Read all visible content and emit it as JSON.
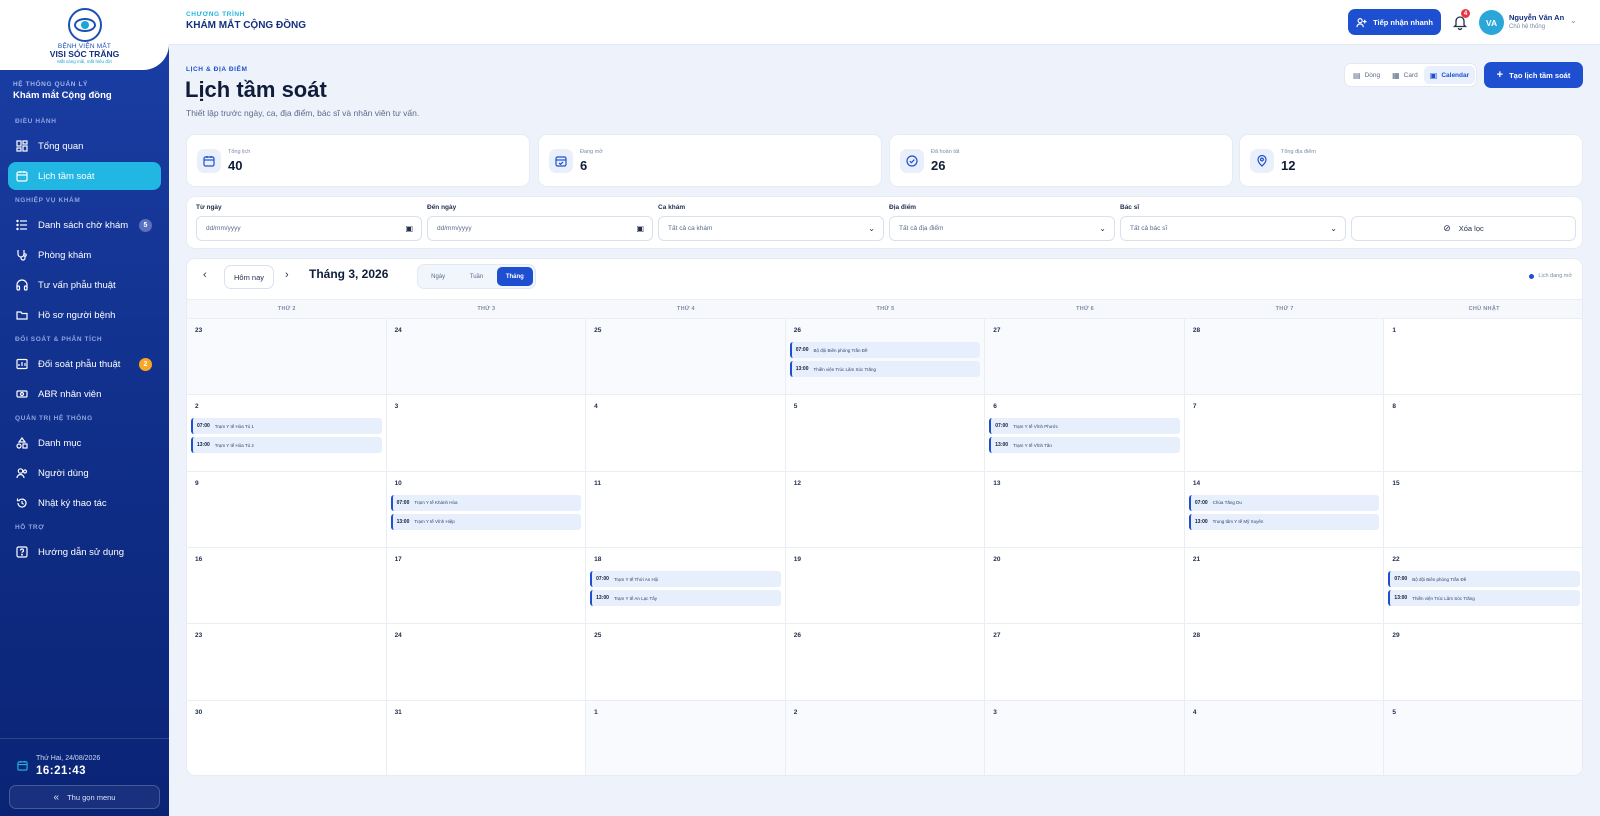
{
  "logo": {
    "line1": "BỆNH VIỆN MẮT",
    "line2": "VISI SÓC TRĂNG",
    "tagline": "Mắt sáng mãi, mắt hiểu đời"
  },
  "sidebar": {
    "system_label": "HỆ THỐNG QUẢN LÝ",
    "system_name": "Khám mắt Cộng đồng",
    "sections": [
      "ĐIỀU HÀNH",
      "NGHIỆP VỤ KHÁM",
      "ĐỐI SOÁT & PHÂN TÍCH",
      "QUẢN TRỊ HỆ THỐNG",
      "HỖ TRỢ"
    ],
    "items": [
      {
        "label": "Tổng quan",
        "icon": "dashboard-icon"
      },
      {
        "label": "Lịch tầm soát",
        "icon": "calendar-icon",
        "active": true
      },
      {
        "label": "Danh sách chờ khám",
        "icon": "list-icon",
        "badge": "5"
      },
      {
        "label": "Phòng khám",
        "icon": "stethoscope-icon"
      },
      {
        "label": "Tư vấn phẫu thuật",
        "icon": "consult-icon"
      },
      {
        "label": "Hồ sơ người bệnh",
        "icon": "folder-icon"
      },
      {
        "label": "Đối soát phẫu thuật",
        "icon": "reconcile-icon",
        "badge": "2"
      },
      {
        "label": "ABR nhân viên",
        "icon": "money-icon"
      },
      {
        "label": "Danh mục",
        "icon": "category-icon"
      },
      {
        "label": "Người dùng",
        "icon": "users-icon"
      },
      {
        "label": "Nhật ký thao tác",
        "icon": "history-icon"
      },
      {
        "label": "Hướng dẫn sử dụng",
        "icon": "help-icon"
      }
    ],
    "date": "Thứ Hai, 24/08/2026",
    "time": "16:21:43",
    "collapse_label": "Thu gọn menu"
  },
  "topbar": {
    "program_small": "CHƯƠNG TRÌNH",
    "program_big": "KHÁM MẮT CỘNG ĐỒNG",
    "quick_button": "Tiếp nhận nhanh",
    "notification_count": "4",
    "avatar_initials": "VA",
    "user_name": "Nguyễn Văn An",
    "user_role": "Chủ hệ thống"
  },
  "header": {
    "kicker": "LỊCH & ĐỊA ĐIỂM",
    "title": "Lịch tầm soát",
    "subtitle": "Thiết lập trước ngày, ca, địa điểm, bác sĩ và nhân viên tư vấn.",
    "views": [
      "Dòng",
      "Card",
      "Calendar"
    ],
    "active_view": "Calendar",
    "create_button": "Tạo lịch tầm soát"
  },
  "stats": [
    {
      "label": "Tổng lịch",
      "value": "40",
      "icon": "calendar-icon"
    },
    {
      "label": "Đang mở",
      "value": "6",
      "icon": "calendar-check-icon"
    },
    {
      "label": "Đã hoàn tất",
      "value": "26",
      "icon": "check-circle-icon"
    },
    {
      "label": "Tổng địa điểm",
      "value": "12",
      "icon": "location-pin-icon"
    }
  ],
  "filters": {
    "from_label": "Từ ngày",
    "from_placeholder": "dd/mm/yyyy",
    "to_label": "Đến ngày",
    "to_placeholder": "dd/mm/yyyy",
    "shift_label": "Ca khám",
    "shift_value": "Tất cả ca khám",
    "place_label": "Địa điểm",
    "place_value": "Tất cả địa điểm",
    "doctor_label": "Bác sĩ",
    "doctor_value": "Tất cả bác sĩ",
    "clear_label": "Xóa lọc"
  },
  "calendar": {
    "today_button": "Hôm nay",
    "month_label": "Tháng 3, 2026",
    "modes": [
      "Ngày",
      "Tuần",
      "Tháng"
    ],
    "active_mode": "Tháng",
    "legend": "Lịch đang mở",
    "weekdays": [
      "THỨ 2",
      "THỨ 3",
      "THỨ 4",
      "THỨ 5",
      "THỨ 6",
      "THỨ 7",
      "CHỦ NHẬT"
    ],
    "cells": [
      {
        "day": "23",
        "other": true,
        "events": []
      },
      {
        "day": "24",
        "other": true,
        "events": []
      },
      {
        "day": "25",
        "other": true,
        "events": []
      },
      {
        "day": "26",
        "other": true,
        "events": [
          {
            "time": "07:00",
            "name": "Bộ đội Biên phòng Trần Đề"
          },
          {
            "time": "13:00",
            "name": "Thiền viện Trúc Lâm Sóc Trăng"
          }
        ]
      },
      {
        "day": "27",
        "other": true,
        "events": []
      },
      {
        "day": "28",
        "other": true,
        "events": []
      },
      {
        "day": "1",
        "other": false,
        "events": []
      },
      {
        "day": "2",
        "other": false,
        "events": [
          {
            "time": "07:00",
            "name": "Trạm Y tế Hòa Tú 1"
          },
          {
            "time": "13:00",
            "name": "Trạm Y tế Hòa Tú 2"
          }
        ]
      },
      {
        "day": "3",
        "other": false,
        "events": []
      },
      {
        "day": "4",
        "other": false,
        "events": []
      },
      {
        "day": "5",
        "other": false,
        "events": []
      },
      {
        "day": "6",
        "other": false,
        "events": [
          {
            "time": "07:00",
            "name": "Trạm Y tế Vĩnh Phước"
          },
          {
            "time": "13:00",
            "name": "Trạm Y tế Vĩnh Tân"
          }
        ]
      },
      {
        "day": "7",
        "other": false,
        "events": []
      },
      {
        "day": "8",
        "other": false,
        "events": []
      },
      {
        "day": "9",
        "other": false,
        "events": []
      },
      {
        "day": "10",
        "other": false,
        "events": [
          {
            "time": "07:00",
            "name": "Trạm Y tế Khánh Hòa"
          },
          {
            "time": "13:00",
            "name": "Trạm Y tế Vĩnh Hiệp"
          }
        ]
      },
      {
        "day": "11",
        "other": false,
        "events": []
      },
      {
        "day": "12",
        "other": false,
        "events": []
      },
      {
        "day": "13",
        "other": false,
        "events": []
      },
      {
        "day": "14",
        "other": false,
        "events": [
          {
            "time": "07:00",
            "name": "Chùa Tăng Du"
          },
          {
            "time": "13:00",
            "name": "Trung tâm Y tế Mỹ Xuyên"
          }
        ]
      },
      {
        "day": "15",
        "other": false,
        "events": []
      },
      {
        "day": "16",
        "other": false,
        "events": []
      },
      {
        "day": "17",
        "other": false,
        "events": []
      },
      {
        "day": "18",
        "other": false,
        "events": [
          {
            "time": "07:00",
            "name": "Trạm Y tế Thới An Hội"
          },
          {
            "time": "13:00",
            "name": "Trạm Y tế An Lạc Tây"
          }
        ]
      },
      {
        "day": "19",
        "other": false,
        "events": []
      },
      {
        "day": "20",
        "other": false,
        "events": []
      },
      {
        "day": "21",
        "other": false,
        "events": []
      },
      {
        "day": "22",
        "other": false,
        "events": [
          {
            "time": "07:00",
            "name": "Bộ đội Biên phòng Trần Đề"
          },
          {
            "time": "13:00",
            "name": "Thiền viện Trúc Lâm Sóc Trăng"
          }
        ]
      },
      {
        "day": "23",
        "other": false,
        "events": []
      },
      {
        "day": "24",
        "other": false,
        "events": []
      },
      {
        "day": "25",
        "other": false,
        "events": []
      },
      {
        "day": "26",
        "other": false,
        "events": []
      },
      {
        "day": "27",
        "other": false,
        "events": []
      },
      {
        "day": "28",
        "other": false,
        "events": []
      },
      {
        "day": "29",
        "other": false,
        "events": []
      },
      {
        "day": "30",
        "other": false,
        "events": []
      },
      {
        "day": "31",
        "other": false,
        "events": []
      },
      {
        "day": "1",
        "other": true,
        "events": []
      },
      {
        "day": "2",
        "other": true,
        "events": []
      },
      {
        "day": "3",
        "other": true,
        "events": []
      },
      {
        "day": "4",
        "other": true,
        "events": []
      },
      {
        "day": "5",
        "other": true,
        "events": []
      }
    ]
  },
  "colors": {
    "primary": "#1d4fd0",
    "accent": "#22b7e3",
    "sidebar": "#12307f"
  }
}
